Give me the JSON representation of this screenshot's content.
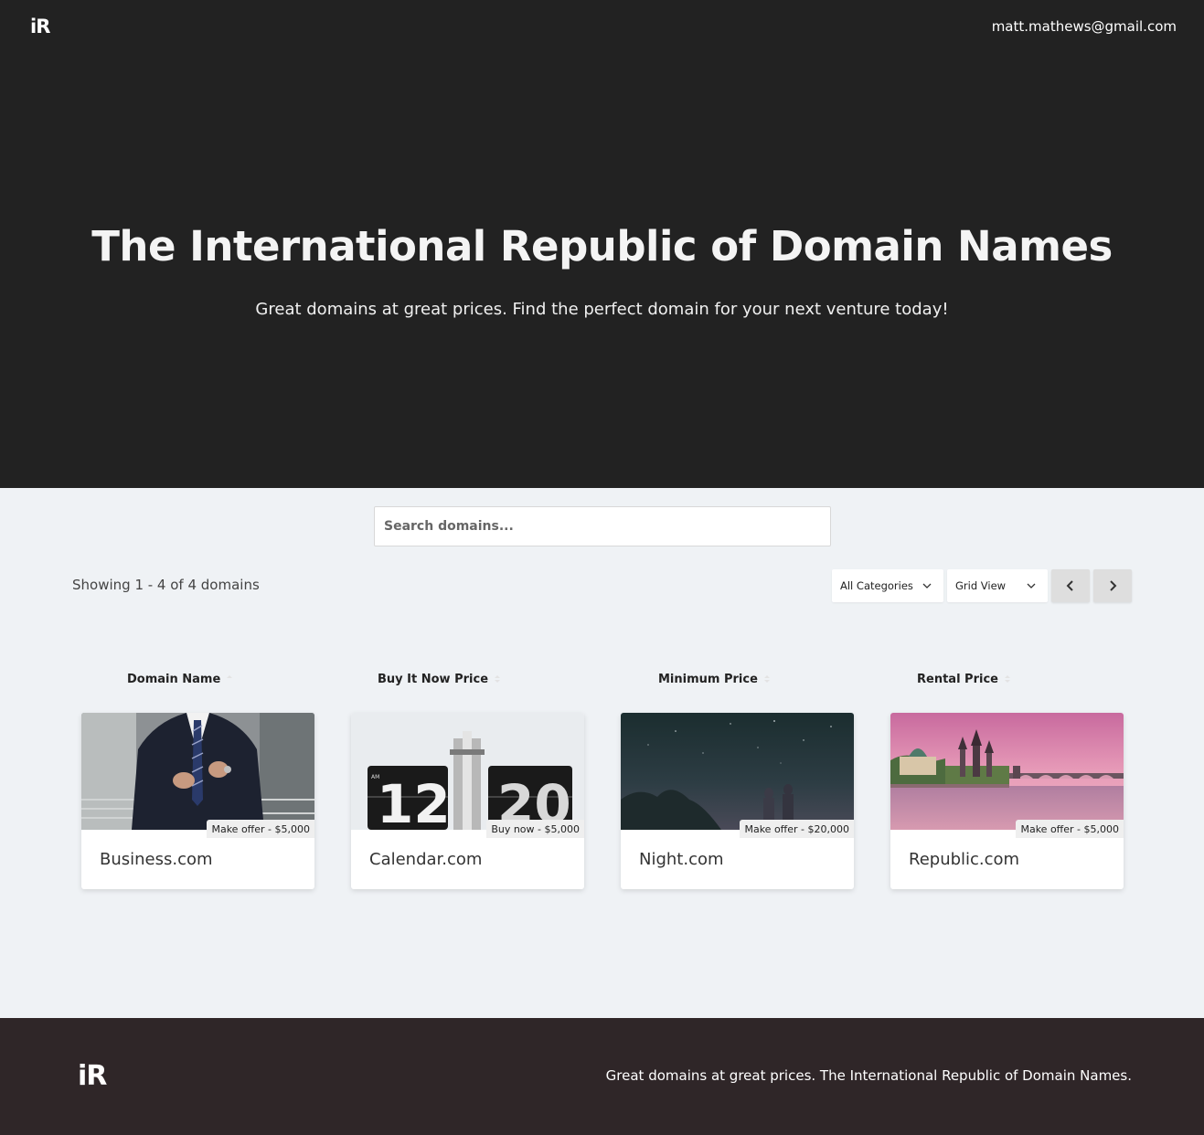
{
  "header": {
    "logo": "iR",
    "email": "matt.mathews@gmail.com"
  },
  "hero": {
    "title": "The International Republic of Domain Names",
    "subtitle": "Great domains at great prices. Find the perfect domain for your next venture today!"
  },
  "search": {
    "placeholder": "Search domains..."
  },
  "toolbar": {
    "showing": "Showing 1 - 4 of 4 domains",
    "category": "All Categories",
    "view": "Grid View"
  },
  "columns": [
    "Domain Name",
    "Buy It Now Price",
    "Minimum Price",
    "Rental Price"
  ],
  "domains": [
    {
      "name": "Business.com",
      "badge": "Make offer - $5,000",
      "image": "man in suit"
    },
    {
      "name": "Calendar.com",
      "badge": "Buy now - $5,000",
      "image": "flip clock 12 20"
    },
    {
      "name": "Night.com",
      "badge": "Make offer - $20,000",
      "image": "night sky"
    },
    {
      "name": "Republic.com",
      "badge": "Make offer - $5,000",
      "image": "prague river sunset"
    }
  ],
  "footer": {
    "logo": "iR",
    "text": "Great domains at great prices. The International Republic of Domain Names."
  }
}
